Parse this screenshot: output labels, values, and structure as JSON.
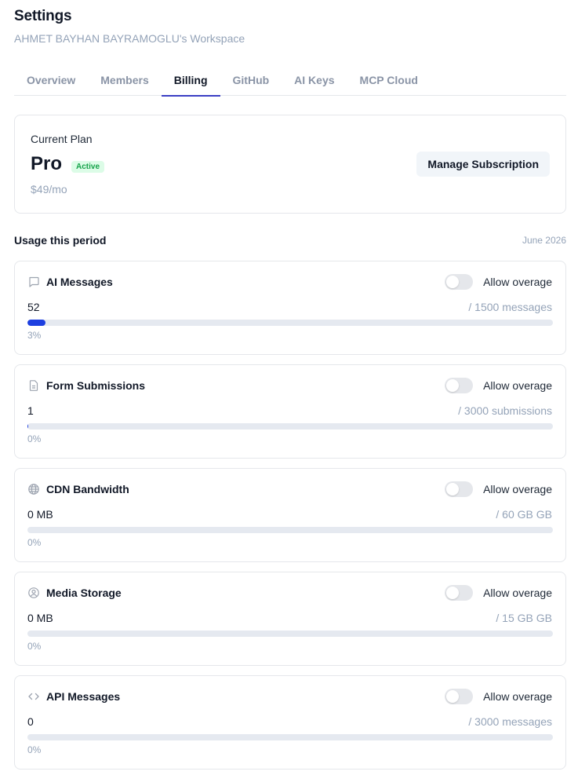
{
  "header": {
    "title": "Settings",
    "subtitle": "AHMET BAYHAN BAYRAMOGLU's Workspace"
  },
  "tabs": [
    {
      "label": "Overview",
      "active": false
    },
    {
      "label": "Members",
      "active": false
    },
    {
      "label": "Billing",
      "active": true
    },
    {
      "label": "GitHub",
      "active": false
    },
    {
      "label": "AI Keys",
      "active": false
    },
    {
      "label": "MCP Cloud",
      "active": false
    }
  ],
  "plan": {
    "label": "Current Plan",
    "name": "Pro",
    "badge": "Active",
    "price": "$49/mo",
    "manage_label": "Manage Subscription"
  },
  "usage": {
    "title": "Usage this period",
    "period": "June 2026",
    "items": [
      {
        "icon": "message-square-icon",
        "name": "AI Messages",
        "overage_label": "Allow overage",
        "overage_enabled": false,
        "used": "52",
        "limit": "/ 1500 messages",
        "percent_label": "3%",
        "fill_fraction": 0.035
      },
      {
        "icon": "file-icon",
        "name": "Form Submissions",
        "overage_label": "Allow overage",
        "overage_enabled": false,
        "used": "1",
        "limit": "/ 3000 submissions",
        "percent_label": "0%",
        "fill_fraction": 0.0003
      },
      {
        "icon": "globe-icon",
        "name": "CDN Bandwidth",
        "overage_label": "Allow overage",
        "overage_enabled": false,
        "used": "0 MB",
        "limit": "/ 60 GB GB",
        "percent_label": "0%",
        "fill_fraction": 0
      },
      {
        "icon": "user-circle-icon",
        "name": "Media Storage",
        "overage_label": "Allow overage",
        "overage_enabled": false,
        "used": "0 MB",
        "limit": "/ 15 GB GB",
        "percent_label": "0%",
        "fill_fraction": 0
      },
      {
        "icon": "code-icon",
        "name": "API Messages",
        "overage_label": "Allow overage",
        "overage_enabled": false,
        "used": "0",
        "limit": "/ 3000 messages",
        "percent_label": "0%",
        "fill_fraction": 0
      }
    ]
  },
  "colors": {
    "accent": "#3b3fc4",
    "progress": "#1d3fe0",
    "badge_text": "#16a34a",
    "badge_bg": "#dcfce7"
  }
}
